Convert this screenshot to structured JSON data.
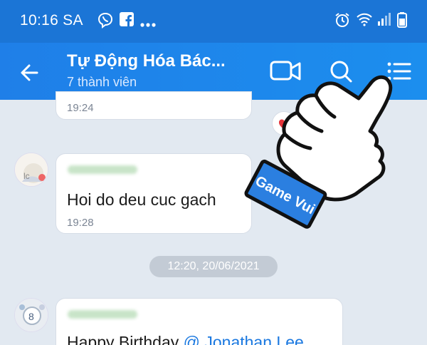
{
  "status_bar": {
    "time": "10:16 SA",
    "icons": [
      "viber-icon",
      "facebook-icon",
      "more-dots-icon",
      "alarm-icon",
      "wifi-icon",
      "signal-icon",
      "battery-icon"
    ]
  },
  "header": {
    "title": "Tự Động Hóa Bác...",
    "subtitle": "7 thành viên",
    "icons": [
      "back-arrow-icon",
      "video-call-icon",
      "search-icon",
      "menu-list-icon"
    ]
  },
  "messages": [
    {
      "time": "19:24"
    },
    {
      "sender": "",
      "text": "Hoi do deu cuc gach",
      "time": "19:28"
    },
    {
      "sender": "",
      "text_prefix": "Happy Birthday ",
      "mention": "@ Jonathan Lee"
    }
  ],
  "date_separator": "12:20, 20/06/2021",
  "watermark": {
    "text": "Game Vui"
  },
  "colors": {
    "header": "#1c86ea",
    "status_bar": "#1b75d6",
    "mention": "#1a78e0",
    "background": "#e2e9f1"
  }
}
